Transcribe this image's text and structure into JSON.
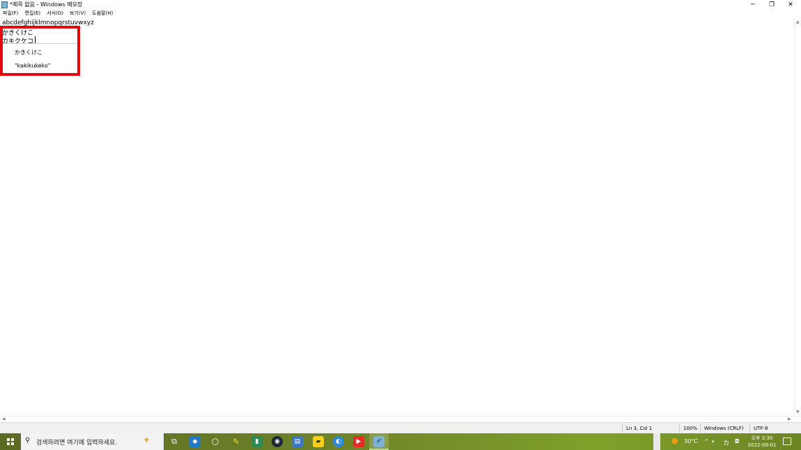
{
  "window": {
    "title": "*제목 없음 - Windows 메모장",
    "minimize_glyph": "─",
    "maximize_glyph": "❐",
    "close_glyph": "✕"
  },
  "menu": [
    {
      "label": "파일(F)"
    },
    {
      "label": "편집(E)"
    },
    {
      "label": "서식(O)"
    },
    {
      "label": "보기(V)"
    },
    {
      "label": "도움말(H)"
    }
  ],
  "editor": {
    "lines": [
      "abcdefghijklmnopqrstuvwxyz",
      "かきくけこ",
      "カキクケコ"
    ]
  },
  "ime": {
    "candidates": [
      "かきくけこ",
      "\"kakikukeko\""
    ],
    "highlight_color": "#e6060d"
  },
  "status": {
    "position": "Ln 3, Col 1",
    "zoom": "100%",
    "line_ending": "Windows (CRLF)",
    "encoding": "UTF-8"
  },
  "taskbar": {
    "search_placeholder": "검색하려면 여기에 입력하세요.",
    "icons": [
      "task-view-icon",
      "vscode-icon",
      "virtualbox-icon",
      "paint-icon",
      "git-icon",
      "steam-icon",
      "ide-icon",
      "sticky-notes-icon",
      "browser-icon",
      "youtube-icon",
      "notepad-icon"
    ],
    "weather": "30°C",
    "ime_indicator": "カ",
    "clock_period": "오후 3:30",
    "clock_date": "2022-09-01"
  },
  "colors": {
    "taskbar": "#6d8228",
    "status_bar": "#f0f0f0"
  }
}
